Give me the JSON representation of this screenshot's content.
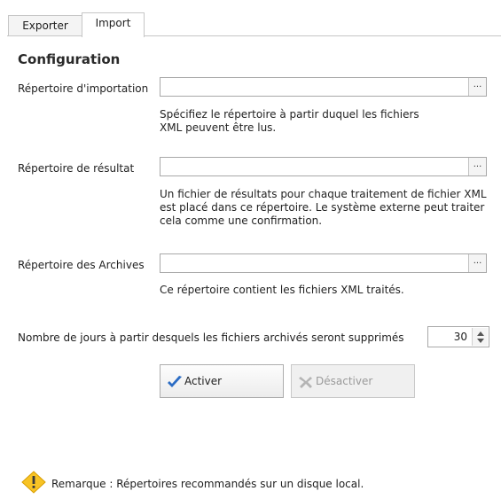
{
  "tabs": [
    {
      "label": "Exporter",
      "active": false
    },
    {
      "label": "Import",
      "active": true
    }
  ],
  "section_title": "Configuration",
  "fields": {
    "import_dir": {
      "label": "Répertoire d'importation",
      "value": "",
      "browse_label": "...",
      "hint": "Spécifiez le répertoire à partir duquel les fichiers XML peuvent être lus."
    },
    "result_dir": {
      "label": "Répertoire de résultat",
      "value": "",
      "browse_label": "...",
      "hint": "Un fichier de résultats pour chaque traitement de fichier XML est placé dans ce répertoire. Le système externe peut traiter cela comme une confirmation."
    },
    "archive_dir": {
      "label": "Répertoire des Archives",
      "value": "",
      "browse_label": "...",
      "hint": "Ce répertoire contient les fichiers XML traités."
    }
  },
  "days": {
    "label": "Nombre de jours à partir desquels les fichiers archivés seront supprimés",
    "value": "30"
  },
  "buttons": {
    "activate": {
      "label": "Activer",
      "icon": "checkmark-icon",
      "enabled": true
    },
    "deactivate": {
      "label": "Désactiver",
      "icon": "cross-icon",
      "enabled": false
    }
  },
  "remark": {
    "text": "Remarque : Répertoires recommandés sur un disque local.",
    "icon": "warning-icon"
  },
  "colors": {
    "accent_check": "#2b6cc4",
    "warning_fill": "#f7c325",
    "disabled_text": "#9a9a9a"
  }
}
